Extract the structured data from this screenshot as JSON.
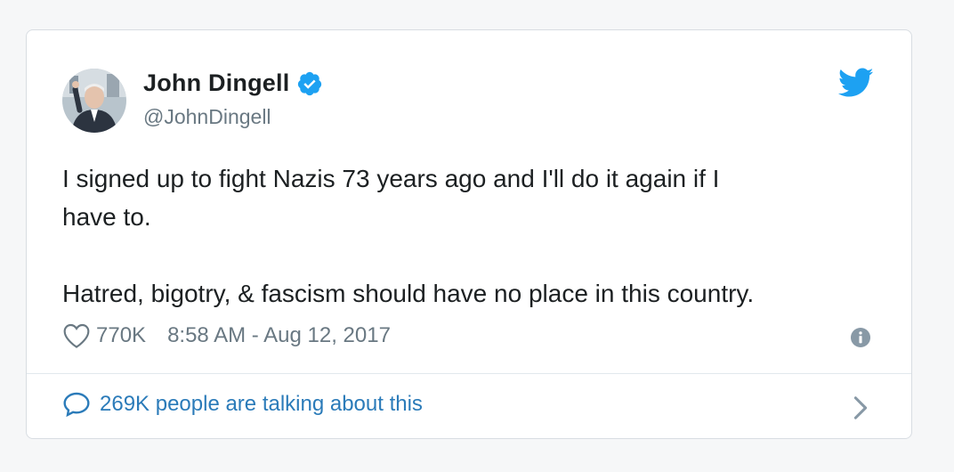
{
  "tweet": {
    "author_name": "John Dingell",
    "handle": "@JohnDingell",
    "text": "I signed up to fight Nazis 73 years ago and I'll do it again if I\nhave to.\n\nHatred, bigotry, & fascism should have no place in this country.",
    "likes": "770K",
    "timestamp": "8:58 AM - Aug 12, 2017",
    "conversation": "269K people are talking about this"
  },
  "icons": {
    "verified": "verified-badge-icon",
    "twitter": "twitter-bird-icon",
    "like": "heart-icon",
    "info": "info-icon",
    "reply": "speech-bubble-icon",
    "more": "chevron-right-icon"
  },
  "colors": {
    "twitter_blue": "#1da1f2",
    "link_blue": "#2b7bb9",
    "text": "#1c2022",
    "secondary": "#697882"
  }
}
